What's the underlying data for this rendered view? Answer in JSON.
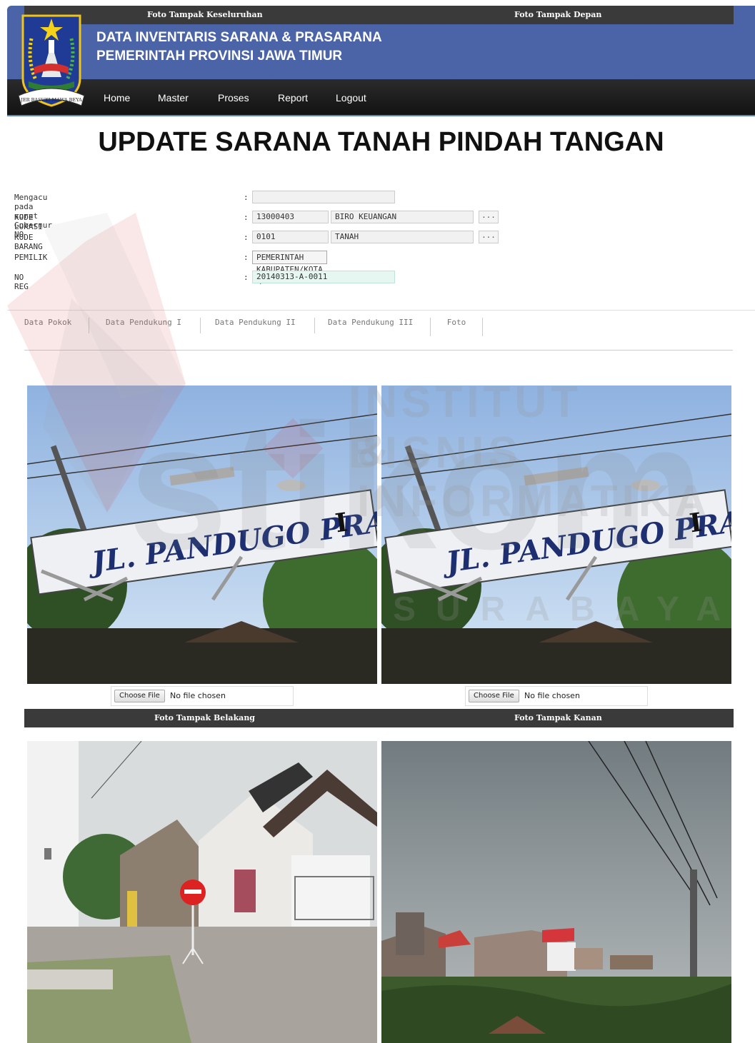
{
  "header": {
    "title_line1": "DATA INVENTARIS SARANA & PRASARANA",
    "title_line2": "PEMERINTAH PROVINSI JAWA TIMUR",
    "logo_ribbon": "JER BASUKI MAWA BEYA"
  },
  "nav": {
    "items": [
      {
        "label": "Home"
      },
      {
        "label": "Master"
      },
      {
        "label": "Proses"
      },
      {
        "label": "Report"
      },
      {
        "label": "Logout"
      }
    ]
  },
  "page_title": "UPDATE SARANA TANAH PINDAH TANGAN",
  "form": {
    "colon": ":",
    "surat": {
      "label": "Mengacu pada surat Gubernur NO",
      "value": ""
    },
    "kode_lokasi": {
      "label": "KODE LOKASI",
      "code": "13000403",
      "name": "BIRO KEUANGAN",
      "browse": "..."
    },
    "kode_barang": {
      "label": "KODE BARANG",
      "code": "0101",
      "name": "TANAH",
      "browse": "..."
    },
    "pemilik": {
      "label": "PEMILIK",
      "selected": "PEMERINTAH KABUPATEN/KOTA",
      "arrow": "▼"
    },
    "no_reg": {
      "label": "NO REG",
      "value": "20140313-A-0011"
    }
  },
  "tabs": [
    {
      "label": "Data Pokok"
    },
    {
      "label": "Data Pendukung I"
    },
    {
      "label": "Data Pendukung II"
    },
    {
      "label": "Data Pendukung III"
    },
    {
      "label": "Foto",
      "active": true
    }
  ],
  "photos": {
    "keseluruhan": {
      "title": "Foto Tampak Keseluruhan",
      "sign_text": "JL. PANDUGO PRAJA",
      "sign_num": "I"
    },
    "depan": {
      "title": "Foto Tampak Depan",
      "sign_text": "JL. PANDUGO PRAJA",
      "sign_num": "I"
    },
    "belakang": {
      "title": "Foto Tampak Belakang"
    },
    "kanan": {
      "title": "Foto Tampak Kanan"
    }
  },
  "file_input": {
    "button": "Choose File",
    "status": "No file chosen"
  },
  "watermark": {
    "line1": "INSTITUT BISNIS",
    "line2": "& INFORMATIKA",
    "brand": "stikom",
    "city": "SURABAYA"
  },
  "colors": {
    "header_bg": "#4b64a8",
    "nav_bg": "#1c1c1c",
    "section_bar": "#3a3a3a",
    "reg_field": "#e6f7f2"
  }
}
